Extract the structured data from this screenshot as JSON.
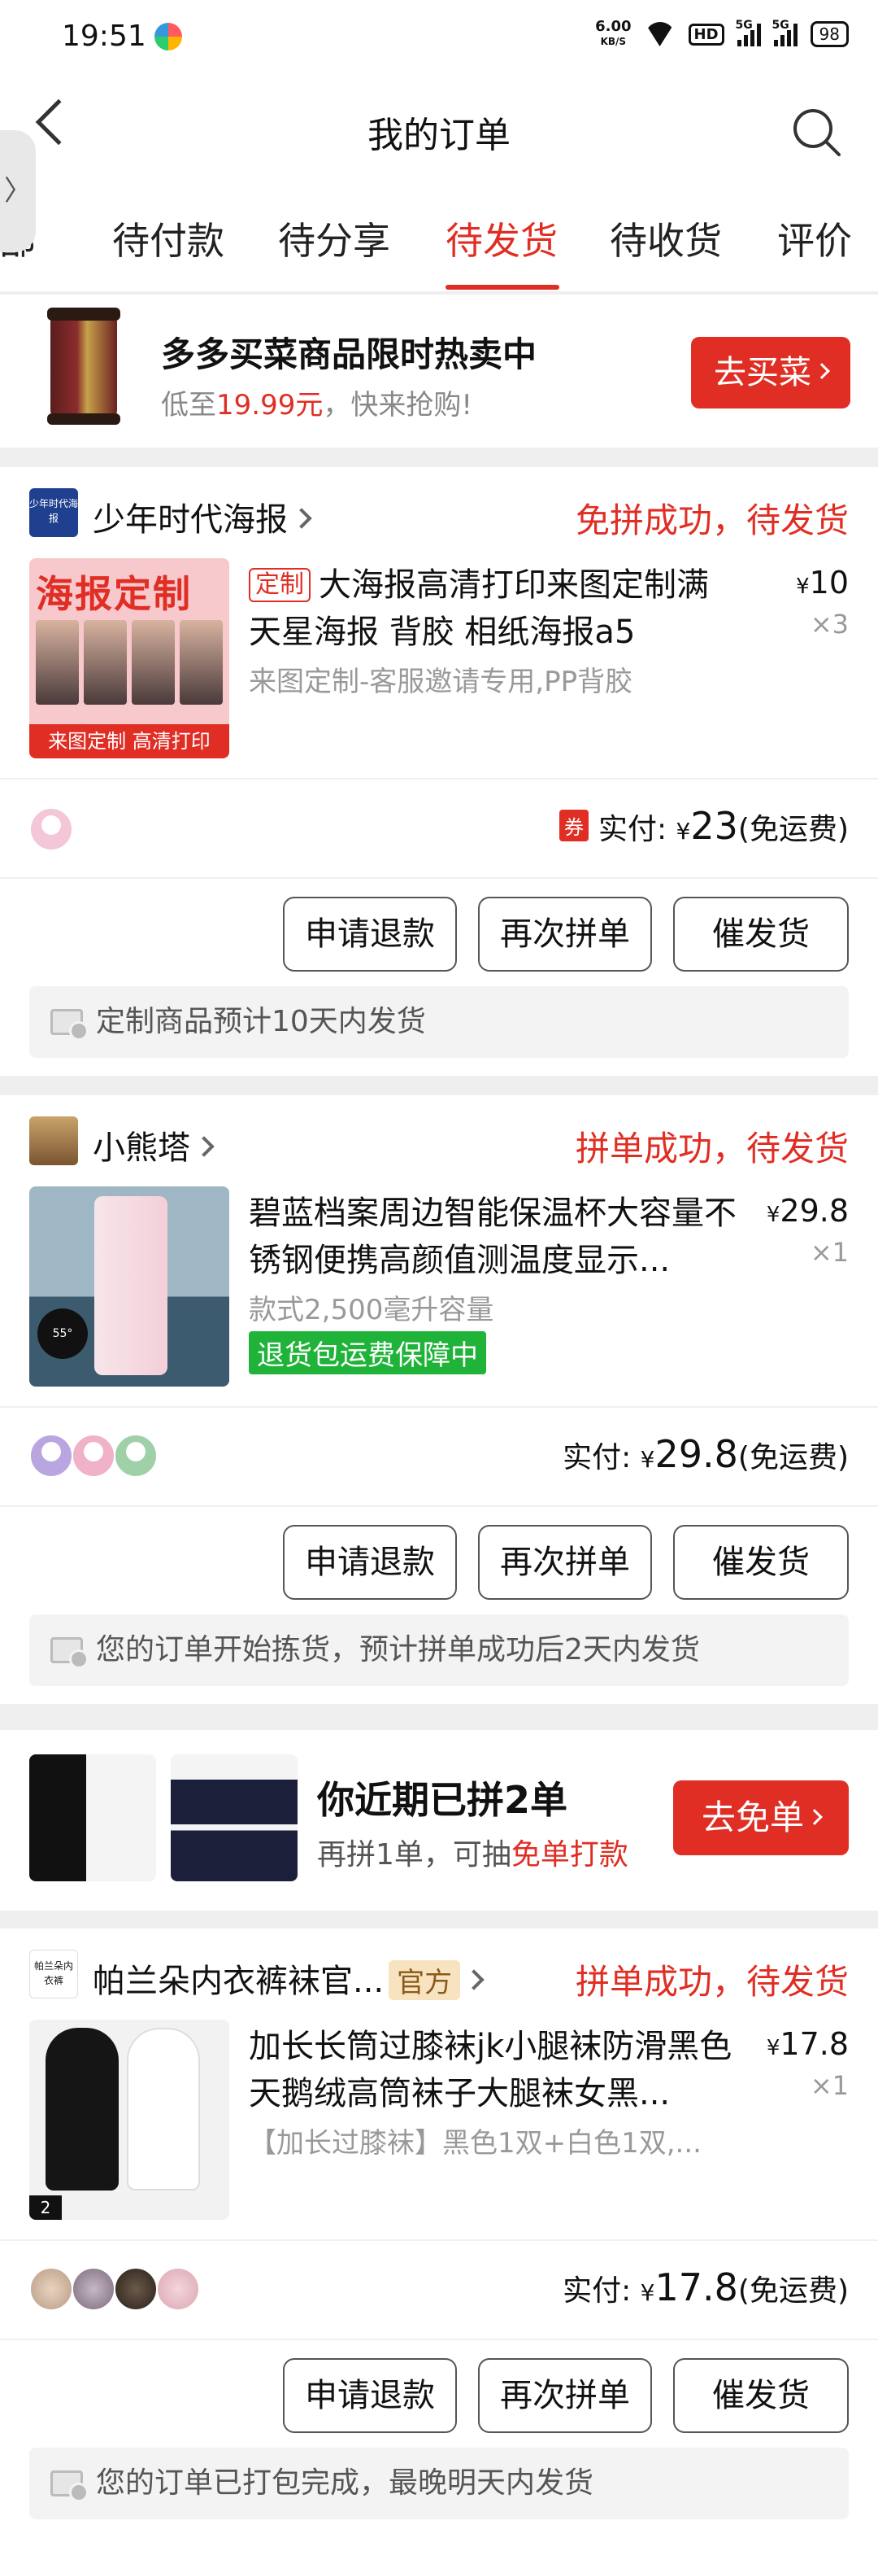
{
  "status_bar": {
    "time": "19:51",
    "net_speed": "6.00",
    "net_unit": "KB/S",
    "hd": "HD",
    "sig1": "5G",
    "sig2": "5G",
    "battery": "98"
  },
  "header": {
    "title": "我的订单"
  },
  "tabs": [
    {
      "label": "全部"
    },
    {
      "label": "待付款"
    },
    {
      "label": "待分享"
    },
    {
      "label": "待发货",
      "active": true
    },
    {
      "label": "待收货"
    },
    {
      "label": "评价"
    }
  ],
  "banner": {
    "title": "多多买菜商品限时热卖中",
    "sub_prefix": "低至",
    "sub_price": "19.99元",
    "sub_suffix": "，快来抢购!",
    "button": "去买菜"
  },
  "orders": [
    {
      "shop": "少年时代海报",
      "shop_logo": "少年时代海报",
      "status": "免拼成功，待发货",
      "tag": "定制",
      "title": "大海报高清打印来图定制满天星海报 背胶 相纸海报a5",
      "spec": "来图定制-客服邀请专用,PP背胶",
      "price": "10",
      "qty": "×3",
      "coupon": "券",
      "paid_label": "实付:",
      "paid_amount": "23",
      "paid_note": "(免运费)",
      "buttons": [
        "申请退款",
        "再次拼单",
        "催发货"
      ],
      "note": "定制商品预计10天内发货",
      "thumb_top": "海报定制",
      "thumb_bottom": "来图定制 高清打印"
    },
    {
      "shop": "小熊塔",
      "status": "拼单成功，待发货",
      "title": "碧蓝档案周边智能保温杯大容量不锈钢便携高颜值测温度显示...",
      "spec": "款式2,500毫升容量",
      "guarantee": "退货包运费保障中",
      "price": "29.8",
      "qty": "×1",
      "paid_label": "实付:",
      "paid_amount": "29.8",
      "paid_note": "(免运费)",
      "buttons": [
        "申请退款",
        "再次拼单",
        "催发货"
      ],
      "note": "您的订单开始拣货，预计拼单成功后2天内发货",
      "thumb_temp": "55°"
    },
    {
      "shop": "帕兰朵内衣裤袜官...",
      "shop_logo": "帕兰朵内衣裤",
      "official": "官方",
      "status": "拼单成功，待发货",
      "title": "加长长筒过膝袜jk小腿袜防滑黑色天鹅绒高筒袜子大腿袜女黑...",
      "spec": "【加长过膝袜】黑色1双+白色1双,...",
      "price": "17.8",
      "qty": "×1",
      "paid_label": "实付:",
      "paid_amount": "17.8",
      "paid_note": "(免运费)",
      "buttons": [
        "申请退款",
        "再次拼单",
        "催发货"
      ],
      "note": "您的订单已打包完成，最晚明天内发货",
      "thumb_badge": "2"
    }
  ],
  "promo": {
    "title": "你近期已拼2单",
    "sub_prefix": "再拼1单，可抽",
    "sub_red": "免单打款",
    "button": "去免单"
  },
  "currency": "¥",
  "colors": {
    "accent": "#e02e24",
    "green": "#1fb33a"
  }
}
